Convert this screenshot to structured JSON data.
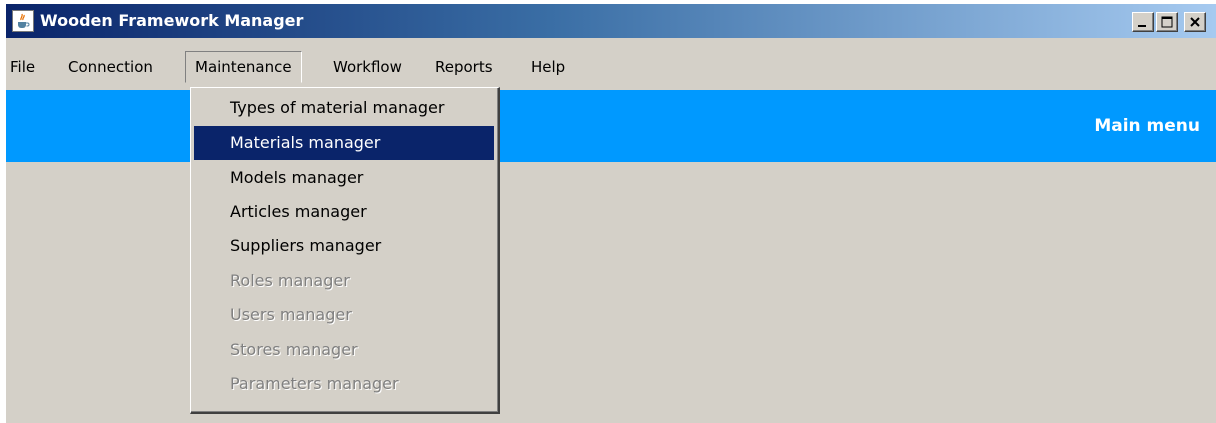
{
  "window": {
    "title": "Wooden Framework Manager",
    "app_icon": "java-cup-icon",
    "controls": [
      "minimize-icon",
      "maximize-icon",
      "close-icon"
    ]
  },
  "menubar": {
    "items": [
      "File",
      "Connection",
      "Maintenance",
      "Workflow",
      "Reports",
      "Help"
    ],
    "active": "Maintenance"
  },
  "banner": {
    "title": "Main menu",
    "color": "#0099ff"
  },
  "maintenance_menu": {
    "items": [
      {
        "label": "Types of material manager",
        "enabled": true
      },
      {
        "label": "Materials manager",
        "enabled": true,
        "selected": true
      },
      {
        "label": "Models manager",
        "enabled": true
      },
      {
        "label": "Articles manager",
        "enabled": true
      },
      {
        "label": "Suppliers manager",
        "enabled": true
      },
      {
        "label": "Roles manager",
        "enabled": false
      },
      {
        "label": "Users manager",
        "enabled": false
      },
      {
        "label": "Stores manager",
        "enabled": false
      },
      {
        "label": "Parameters manager",
        "enabled": false
      }
    ]
  },
  "colors": {
    "title_bar_start": "#0a246a",
    "title_bar_end": "#a6caf0",
    "selection": "#0a246a",
    "window_background": "#d4d0c8",
    "disabled_text": "#808080"
  }
}
